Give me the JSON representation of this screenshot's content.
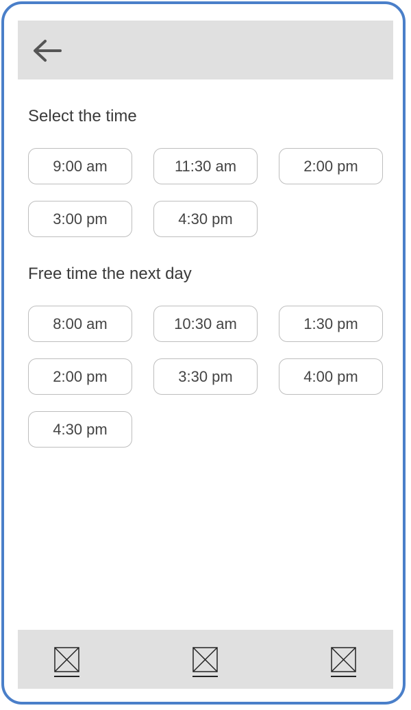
{
  "header": {
    "back_icon": "arrow-left-icon"
  },
  "sections": [
    {
      "title": "Select the time",
      "slots": [
        "9:00 am",
        "11:30 am",
        "2:00 pm",
        "3:00 pm",
        "4:30 pm"
      ]
    },
    {
      "title": "Free time the next day",
      "slots": [
        "8:00 am",
        "10:30 am",
        "1:30 pm",
        "2:00 pm",
        "3:30 pm",
        "4:00 pm",
        "4:30 pm"
      ]
    }
  ],
  "bottom_nav": {
    "items": [
      {
        "icon": "placeholder-image-icon"
      },
      {
        "icon": "placeholder-image-icon"
      },
      {
        "icon": "placeholder-image-icon"
      }
    ]
  },
  "colors": {
    "frame_border": "#4a7fc9",
    "bar_background": "#e0e0e0",
    "slot_border": "#bdbdbd"
  }
}
